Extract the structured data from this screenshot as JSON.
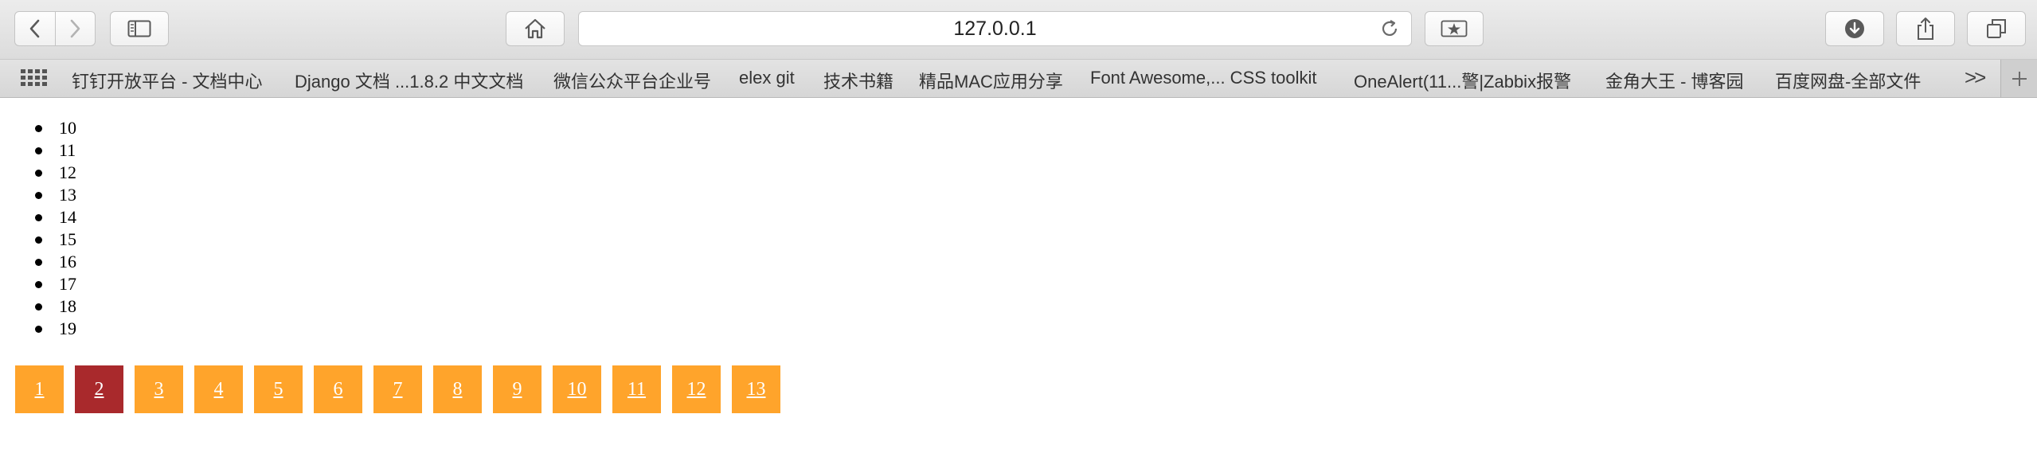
{
  "browser": {
    "url": "127.0.0.1",
    "bookmarks": [
      "钉钉开放平台 - 文档中心",
      "Django 文档 ...1.8.2 中文文档",
      "微信公众平台企业号",
      "elex git",
      "技术书籍",
      "精品MAC应用分享",
      "Font Awesome,... CSS toolkit",
      "OneAlert(11...警|Zabbix报警",
      "金角大王 - 博客园",
      "百度网盘-全部文件"
    ],
    "bookmarks_overflow": ">>"
  },
  "page": {
    "items": [
      "10",
      "11",
      "12",
      "13",
      "14",
      "15",
      "16",
      "17",
      "18",
      "19"
    ],
    "pagination": [
      "1",
      "2",
      "3",
      "4",
      "5",
      "6",
      "7",
      "8",
      "9",
      "10",
      "11",
      "12",
      "13"
    ],
    "current_page": "2",
    "colors": {
      "page_button": "#ffa42b",
      "page_button_active": "#a9292c",
      "page_button_text": "#ffffff"
    }
  }
}
